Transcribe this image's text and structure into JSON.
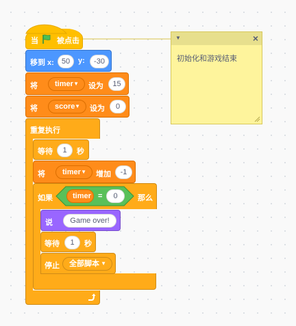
{
  "script": {
    "hat": {
      "when": "当",
      "clicked": "被点击"
    },
    "goto": {
      "label": "移到 x:",
      "x": "50",
      "ylabel": "y:",
      "y": "-30"
    },
    "set_timer": {
      "set": "将",
      "var": "timer",
      "to": "设为",
      "value": "15"
    },
    "set_score": {
      "set": "将",
      "var": "score",
      "to": "设为",
      "value": "0"
    },
    "forever": {
      "label": "重复执行"
    },
    "wait1": {
      "label": "等待",
      "value": "1",
      "unit": "秒"
    },
    "change_timer": {
      "set": "将",
      "var": "timer",
      "by": "增加",
      "value": "-1"
    },
    "if_block": {
      "if": "如果",
      "then": "那么",
      "var": "timer",
      "eq": "=",
      "value": "0"
    },
    "say": {
      "label": "说",
      "text": "Game over!"
    },
    "wait2": {
      "label": "等待",
      "value": "1",
      "unit": "秒"
    },
    "stop": {
      "label": "停止",
      "option": "全部脚本"
    }
  },
  "comment": {
    "text": "初始化和游戏结束",
    "close": "×"
  },
  "colors": {
    "events": "#ffbf00",
    "motion": "#4c97ff",
    "variables": "#ff8c1a",
    "control": "#ffab19",
    "operators": "#59c059",
    "looks": "#9966ff",
    "note": "#fef49c"
  },
  "icons": {
    "flag": "green-flag-icon",
    "repeat_arrow": "loop-arrow-icon"
  }
}
